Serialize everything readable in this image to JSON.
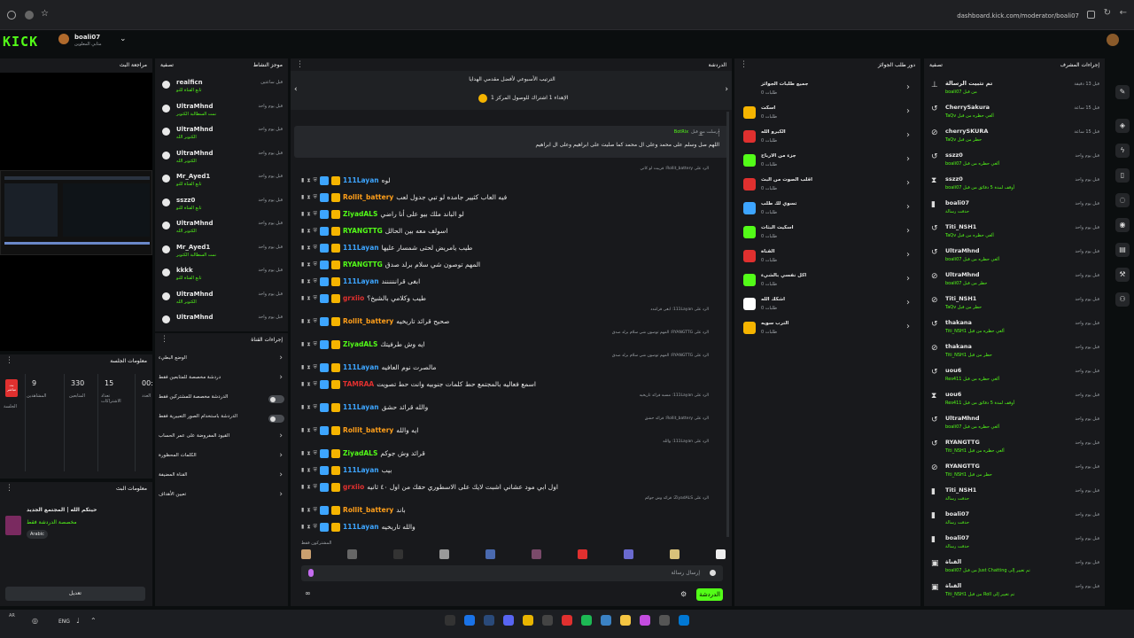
{
  "browser": {
    "url": "dashboard.kick.com/moderator/boali07"
  },
  "header": {
    "logo": "KICK",
    "username": "boali07",
    "user_subtitle": "مثابي المعلوين"
  },
  "stream_panel": {
    "title": "مراجعة البث"
  },
  "stream_info": {
    "title": "معلومات الجلسة",
    "live_label": "بث مباشر",
    "session_label": "الجلسة",
    "stats": [
      {
        "value": "9",
        "label": "المشاهدين"
      },
      {
        "value": "330",
        "label": "المتابعين"
      },
      {
        "value": "15",
        "label": "تعداد الاشتراكات"
      },
      {
        "value": "00:",
        "label": "العدد"
      }
    ]
  },
  "broadcast_info": {
    "title": "معلومات البث",
    "stream_title": "حيتكم الله | المجتمع الجديد",
    "category": "مخصصة الدردشة فقط",
    "language": "Arabic",
    "edit_button": "تعديل"
  },
  "activity": {
    "title": "موجز النشاط",
    "filter": "تصفية",
    "items": [
      {
        "name": "realficn",
        "sub": "تابع القناة للتو",
        "time": "قبل ساعتين"
      },
      {
        "name": "UltraMhnd",
        "sub": "نمت السطالبة الكتوبر",
        "time": "قبل يوم واحد"
      },
      {
        "name": "UltraMhnd",
        "sub": "الكتوبر الله",
        "time": "قبل يوم واحد"
      },
      {
        "name": "UltraMhnd",
        "sub": "الكتوبر الله",
        "time": "قبل يوم واحد"
      },
      {
        "name": "Mr_Ayed1",
        "sub": "تابع القناة للتو",
        "time": "قبل يوم واحد"
      },
      {
        "name": "sszz0",
        "sub": "تابع القناة للتو",
        "time": "قبل يوم واحد"
      },
      {
        "name": "UltraMhnd",
        "sub": "الكتوبر الله",
        "time": "قبل يوم واحد"
      },
      {
        "name": "Mr_Ayed1",
        "sub": "نمت السطالبة الكتوبر",
        "time": "قبل يوم واحد"
      },
      {
        "name": "kkkk",
        "sub": "تابع القناة للتو",
        "time": "قبل يوم واحد"
      },
      {
        "name": "UltraMhnd",
        "sub": "الكتوبر الله",
        "time": "قبل يوم واحد"
      },
      {
        "name": "UltraMhnd",
        "sub": "",
        "time": "قبل يوم واحد"
      }
    ]
  },
  "channel_settings": {
    "title": "إجراءات القناة",
    "items": [
      {
        "label": "الوضع البطيء"
      },
      {
        "label": "دردشة مخصصة للمتابعين فقط"
      },
      {
        "label": "الدردشة مخصصة للمشتركين فقط"
      },
      {
        "label": "الدردشة باستخدام الصور التعبيرية فقط"
      },
      {
        "label": "القيود المفروضة على عمر الحساب"
      },
      {
        "label": "الكلمات المحظورة"
      },
      {
        "label": "القناة المضيفة"
      },
      {
        "label": "تعيين الأهداف"
      }
    ]
  },
  "chat": {
    "title": "الدردشة",
    "pinned_title": "الترتيب الأسبوعي لأفضل مقدمي الهدايا",
    "pinned_sub": "الإهداء 1 اشتراك للوصول المركز 1",
    "botrix_label": "أرسلت من قبل",
    "botrix_name": "BotRix",
    "botrix_message": "اللهم صل وسلم على محمد وعلى ال محمد كما صليت على ابراهيم وعلى ال ابراهيم",
    "messages": [
      {
        "reply": "الرد على Rollit_battery: قريبت لو كاني",
        "user": "111Layan",
        "color": "#3da5ff",
        "text": "لوه"
      },
      {
        "reply": "",
        "user": "Rollit_battery",
        "color": "#ff9f1a",
        "text": "فيه العاب كثيير جامده لو تبي جدول لعب"
      },
      {
        "reply": "",
        "user": "ZiyadALS",
        "color": "#53fc18",
        "text": "لو الباند ملك بيو على أنا راضي"
      },
      {
        "reply": "",
        "user": "RYANGTTG",
        "color": "#53fc18",
        "text": "اسولف معه بين الحالل"
      },
      {
        "reply": "",
        "user": "111Layan",
        "color": "#3da5ff",
        "text": "طيب يامريض لحتى شمسار عليها"
      },
      {
        "reply": "",
        "user": "RYANGTTG",
        "color": "#53fc18",
        "text": "المهم توصون شي سلام برلد صدق"
      },
      {
        "reply": "",
        "user": "111Layan",
        "color": "#3da5ff",
        "text": "ابغى قرانننننند"
      },
      {
        "reply": "",
        "user": "grxiio",
        "color": "#e0302f",
        "text": "طيب وكلامي بالشيخ؟"
      },
      {
        "reply": "الرد على 111Layan: ابغى قرانندد",
        "user": "Rollit_battery",
        "color": "#ff9f1a",
        "text": "صحيح قرائد تاريخيه"
      },
      {
        "reply": "الرد على RYANGTTG: المهم توصون شي سلام برلد صدق",
        "user": "ZiyadALS",
        "color": "#53fc18",
        "text": "ايه وش طرفيتك"
      },
      {
        "reply": "الرد على RYANGTTG: المهم توصون شي سلام برلد صدق",
        "user": "111Layan",
        "color": "#3da5ff",
        "text": "مالصرت نوم العافيه"
      },
      {
        "reply": "",
        "user": "TAMRAA",
        "color": "#e0302f",
        "text": "اسمع فعاليه بالمجتمع حط كلمات جنوبيه وانت حط تصويت"
      },
      {
        "reply": "الرد على 111Layan: مسبه قرائد تاريخيه",
        "user": "111Layan",
        "color": "#3da5ff",
        "text": "والله قرائد حشق"
      },
      {
        "reply": "الرد على Rollit_battery: قرائد حشق",
        "user": "Rollit_battery",
        "color": "#ff9f1a",
        "text": "ايه والله"
      },
      {
        "reply": "الرد على 111Layan: والله",
        "user": "ZiyadALS",
        "color": "#53fc18",
        "text": "قرائد وش جوكم"
      },
      {
        "reply": "",
        "user": "111Layan",
        "color": "#3da5ff",
        "text": "بيب"
      },
      {
        "reply": "",
        "user": "grxiio",
        "color": "#e0302f",
        "text": "اول ابي مود عشاني اشبت لايك على الاسطوري حقك من اول ٤٠ ثانيه"
      },
      {
        "reply": "الرد على ZiyadALS: قرائد وش جوكم",
        "user": "Rollit_battery",
        "color": "#ff9f1a",
        "text": "باند"
      },
      {
        "reply": "",
        "user": "111Layan",
        "color": "#3da5ff",
        "text": "والله تاريخيه"
      }
    ],
    "input_placeholder": "إرسال رسالة",
    "send_button": "الدردشة",
    "emote_label": "المشتركون فقط"
  },
  "rewards": {
    "title": "دور طلب الجوائز",
    "items": [
      {
        "name": "جميع طلبات الجوائز",
        "sub": "طلبات 0"
      },
      {
        "name": "اسكت",
        "sub": "طلبات 0"
      },
      {
        "name": "الكبرو الله",
        "sub": "طلبات 0"
      },
      {
        "name": "جزء من الارباح",
        "sub": "طلبات 0"
      },
      {
        "name": "اقلب الصوت من البث",
        "sub": "طلبات 0"
      },
      {
        "name": "تسوي لك طلب",
        "sub": "طلبات 0"
      },
      {
        "name": "اسكيت البثات",
        "sub": "طلبات 0"
      },
      {
        "name": "القناة",
        "sub": "طلبات 0"
      },
      {
        "name": "اكل نفسي بالشيء",
        "sub": "طلبات 0"
      },
      {
        "name": "اشكك الله",
        "sub": "طلبات 0"
      },
      {
        "name": "الترب سويه",
        "sub": "طلبات 0"
      }
    ]
  },
  "mod_actions": {
    "title": "إجراءات المشرف",
    "filter": "تصفية",
    "items": [
      {
        "user": "تم تثبيت الرسالة",
        "sub": "من قبل boali07",
        "time": "قبل 13 دقيقة"
      },
      {
        "user": "CherrySakura",
        "sub": "ألغي حظره من قبل TaQv",
        "time": "قبل 15 ساعة"
      },
      {
        "user": "cherrySKURA",
        "sub": "حظر من قبل TaQv",
        "time": "قبل 15 ساعة"
      },
      {
        "user": "sszz0",
        "sub": "ألغي حظره من قبل boali07",
        "time": "قبل يوم واحد"
      },
      {
        "user": "sszz0",
        "sub": "أوقف لمدة 5 دقائق من قبل boali07",
        "time": "قبل يوم واحد"
      },
      {
        "user": "boali07",
        "sub": "حذفت رسالة",
        "time": "قبل يوم واحد"
      },
      {
        "user": "Titi_NSH1",
        "sub": "ألغي حظره من قبل TaQv",
        "time": "قبل يوم واحد"
      },
      {
        "user": "UltraMhnd",
        "sub": "ألغي حظره من قبل boali07",
        "time": "قبل يوم واحد"
      },
      {
        "user": "UltraMhnd",
        "sub": "حظر من قبل boali07",
        "time": "قبل يوم واحد"
      },
      {
        "user": "Titi_NSH1",
        "sub": "حظر من قبل TaQv",
        "time": "قبل يوم واحد"
      },
      {
        "user": "thakana",
        "sub": "ألغي حظره من قبل Titi_NSH1",
        "time": "قبل يوم واحد"
      },
      {
        "user": "thakana",
        "sub": "حظر من قبل Titi_NSH1",
        "time": "قبل يوم واحد"
      },
      {
        "user": "uou6",
        "sub": "ألغي حظره من قبل Res411",
        "time": "قبل يوم واحد"
      },
      {
        "user": "uou6",
        "sub": "أوقف لمدة 5 دقائق من قبل Res411",
        "time": "قبل يوم واحد"
      },
      {
        "user": "UltraMhnd",
        "sub": "ألغي حظره من قبل boali07",
        "time": "قبل يوم واحد"
      },
      {
        "user": "RYANGTTG",
        "sub": "ألغي حظره من قبل Titi_NSH1",
        "time": "قبل يوم واحد"
      },
      {
        "user": "RYANGTTG",
        "sub": "حظر من قبل Titi_NSH1",
        "time": "قبل يوم واحد"
      },
      {
        "user": "Titi_NSH1",
        "sub": "حذفت رسالة",
        "time": "قبل يوم واحد"
      },
      {
        "user": "boali07",
        "sub": "حذفت رسالة",
        "time": "قبل يوم واحد"
      },
      {
        "user": "boali07",
        "sub": "حذفت رسالة",
        "time": "قبل يوم واحد"
      },
      {
        "user": "القناة",
        "sub": "تم تغيير إلى Just Chatting من قبل boali07",
        "time": "قبل يوم واحد"
      },
      {
        "user": "القناة",
        "sub": "تم تغيير إلى Roll من قبل Titi_NSH1",
        "time": "قبل يوم واحد"
      }
    ]
  },
  "taskbar": {
    "lang": "ENG",
    "tray_text": "AR"
  }
}
